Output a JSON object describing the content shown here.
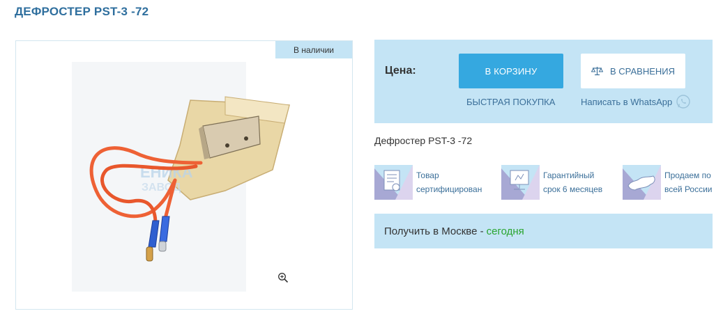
{
  "product": {
    "title": "ДЕФРОСТЕР PST-3 -72",
    "name": "Дефростер PST-3 -72",
    "stock_badge": "В наличии"
  },
  "buy_panel": {
    "price_label": "Цена:",
    "cart_button": "В КОРЗИНУ",
    "compare_button": "В СРАВНЕНИЯ",
    "quick_buy": "БЫСТРАЯ ПОКУПКА",
    "whatsapp": "Написать в WhatsApp"
  },
  "features": [
    {
      "line1": "Товар",
      "line2": "сертифицирован",
      "icon": "certificate-icon"
    },
    {
      "line1": "Гарантийный",
      "line2": "срок 6 месяцев",
      "icon": "warranty-icon"
    },
    {
      "line1": "Продаем по",
      "line2": "всей России",
      "icon": "russia-map-icon"
    }
  ],
  "delivery": {
    "prefix": "Получить в Москве -",
    "when": "сегодня"
  },
  "colors": {
    "accent": "#35a8e0",
    "panel": "#c4e4f5",
    "link": "#3b6f99",
    "title": "#2f6f9e",
    "success": "#2aa52f"
  }
}
